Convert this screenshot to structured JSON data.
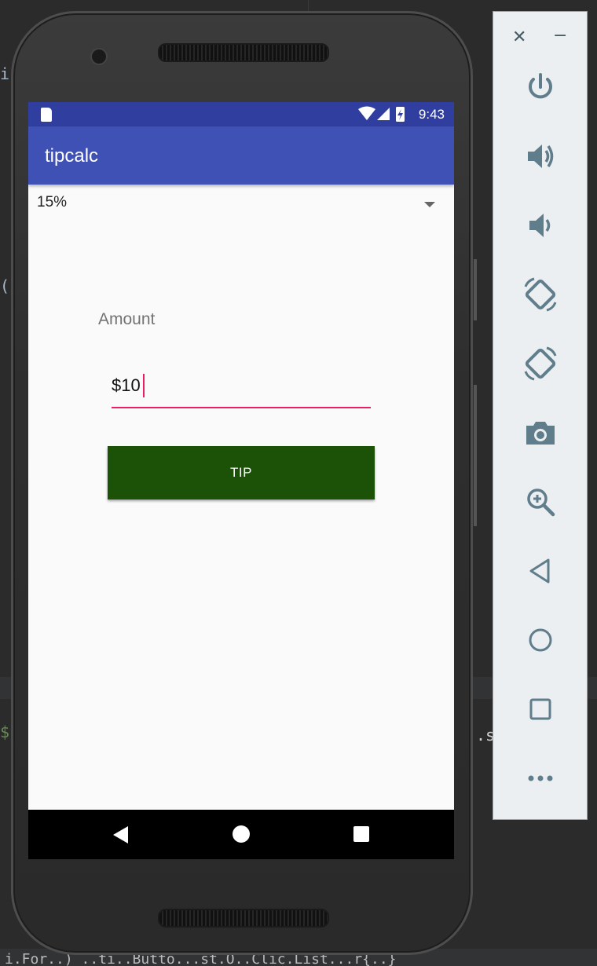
{
  "app": {
    "title": "tipcalc"
  },
  "status_bar": {
    "time": "9:43"
  },
  "spinner": {
    "selected": "15%"
  },
  "amount": {
    "label": "Amount",
    "value": "$10"
  },
  "tip_button": {
    "label": "TIP"
  },
  "colors": {
    "primary": "#3f51b5",
    "primary_dark": "#303f9f",
    "accent": "#e91e63",
    "button": "#1b5207",
    "toolbar_icon": "#607d8b"
  },
  "emulator_toolbar": {
    "close_label": "✕",
    "minimize_label": "−",
    "items": [
      "power-icon",
      "volume-up-icon",
      "volume-down-icon",
      "rotate-left-icon",
      "rotate-right-icon",
      "camera-icon",
      "zoom-icon",
      "back-icon",
      "home-icon",
      "overview-icon",
      "more-icon"
    ]
  },
  "ide_background": {
    "bottom_text": "i.For..) ..ti..Butto...st.O..Clic.List...r{..}"
  }
}
